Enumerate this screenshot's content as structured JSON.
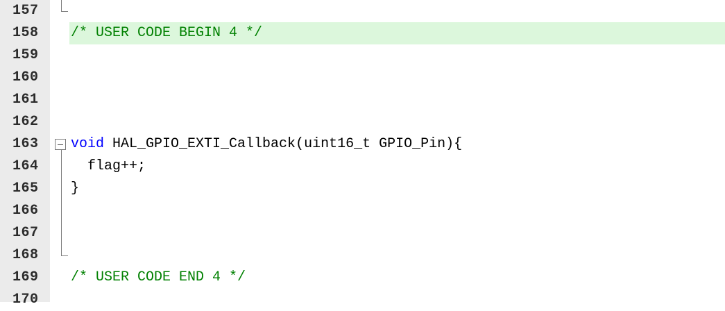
{
  "editor": {
    "lines": [
      {
        "number": "157",
        "code": ""
      },
      {
        "number": "158",
        "code": "/* USER CODE BEGIN 4 */"
      },
      {
        "number": "159",
        "code": ""
      },
      {
        "number": "160",
        "code": ""
      },
      {
        "number": "161",
        "code": ""
      },
      {
        "number": "162",
        "code": ""
      },
      {
        "number": "163",
        "code_keyword": "void",
        "code_rest": " HAL_GPIO_EXTI_Callback(uint16_t GPIO_Pin){"
      },
      {
        "number": "164",
        "code": "  flag++;"
      },
      {
        "number": "165",
        "code": "}"
      },
      {
        "number": "166",
        "code": ""
      },
      {
        "number": "167",
        "code": ""
      },
      {
        "number": "168",
        "code": ""
      },
      {
        "number": "169",
        "code": "/* USER CODE END 4 */"
      },
      {
        "number": "170",
        "code": ""
      }
    ],
    "colors": {
      "comment": "#008000",
      "keyword": "#0000ff",
      "highlight_line": "#dcf7dc",
      "gutter": "#ebebeb"
    }
  }
}
